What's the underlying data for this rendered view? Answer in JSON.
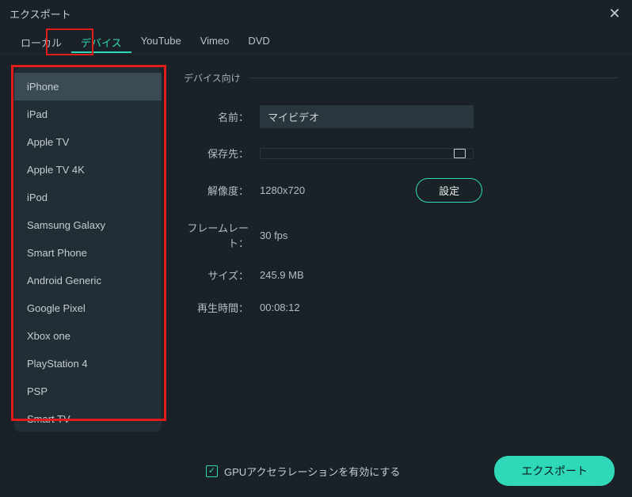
{
  "window": {
    "title": "エクスポート"
  },
  "tabs": {
    "local": "ローカル",
    "device": "デバイス",
    "youtube": "YouTube",
    "vimeo": "Vimeo",
    "dvd": "DVD"
  },
  "devices": [
    "iPhone",
    "iPad",
    "Apple TV",
    "Apple TV 4K",
    "iPod",
    "Samsung Galaxy",
    "Smart Phone",
    "Android Generic",
    "Google Pixel",
    "Xbox one",
    "PlayStation 4",
    "PSP",
    "Smart TV"
  ],
  "section_title": "デバイス向け",
  "labels": {
    "name": "名前：",
    "save_to": "保存先：",
    "resolution": "解像度：",
    "framerate": "フレームレート：",
    "size": "サイズ：",
    "duration": "再生時間："
  },
  "values": {
    "name": "マイビデオ",
    "save_to": "",
    "resolution": "1280x720",
    "framerate": "30 fps",
    "size": "245.9 MB",
    "duration": "00:08:12"
  },
  "buttons": {
    "settings": "設定",
    "export": "エクスポート"
  },
  "footer": {
    "gpu_accel": "GPUアクセラレーションを有効にする"
  }
}
